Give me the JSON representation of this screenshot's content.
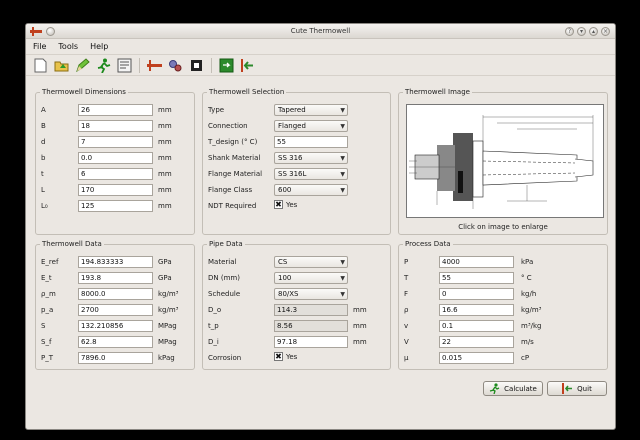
{
  "window": {
    "title": "Cute Thermowell"
  },
  "menu": [
    "File",
    "Tools",
    "Help"
  ],
  "toolbar": {
    "icons": [
      "new-icon",
      "open-icon",
      "pencil-icon",
      "run-icon",
      "report-icon",
      "thermowell-icon",
      "gears-icon",
      "export-icon",
      "save-icon",
      "quit-icon"
    ]
  },
  "dims": {
    "title": "Thermowell Dimensions",
    "rows": [
      {
        "label": "A",
        "value": "26",
        "unit": "mm"
      },
      {
        "label": "B",
        "value": "18",
        "unit": "mm"
      },
      {
        "label": "d",
        "value": "7",
        "unit": "mm"
      },
      {
        "label": "b",
        "value": "0.0",
        "unit": "mm"
      },
      {
        "label": "t",
        "value": "6",
        "unit": "mm"
      },
      {
        "label": "L",
        "value": "170",
        "unit": "mm"
      },
      {
        "label": "L₀",
        "value": "125",
        "unit": "mm"
      }
    ]
  },
  "sel": {
    "title": "Thermowell Selection",
    "rows": [
      {
        "label": "Type",
        "value": "Tapered",
        "kind": "select"
      },
      {
        "label": "Connection",
        "value": "Flanged",
        "kind": "select"
      },
      {
        "label": "T_design (° C)",
        "value": "55",
        "kind": "input"
      },
      {
        "label": "Shank Material",
        "value": "SS 316",
        "kind": "select"
      },
      {
        "label": "Flange Material",
        "value": "SS 316L",
        "kind": "select"
      },
      {
        "label": "Flange Class",
        "value": "600",
        "kind": "select"
      }
    ],
    "ndt_label": "NDT Required",
    "ndt_value": "Yes"
  },
  "image": {
    "title": "Thermowell Image",
    "caption": "Click on image to enlarge"
  },
  "tdata": {
    "title": "Thermowell Data",
    "rows": [
      {
        "label": "E_ref",
        "value": "194.833333",
        "unit": "GPa"
      },
      {
        "label": "E_t",
        "value": "193.8",
        "unit": "GPa"
      },
      {
        "label": "ρ_m",
        "value": "8000.0",
        "unit": "kg/m³"
      },
      {
        "label": "p_a",
        "value": "2700",
        "unit": "kg/m³"
      },
      {
        "label": "S",
        "value": "132.210856",
        "unit": "MPag"
      },
      {
        "label": "S_f",
        "value": "62.8",
        "unit": "MPag"
      },
      {
        "label": "P_T",
        "value": "7896.0",
        "unit": "kPag"
      }
    ]
  },
  "pipe": {
    "title": "Pipe Data",
    "rows": [
      {
        "label": "Material",
        "value": "CS",
        "kind": "select",
        "unit": ""
      },
      {
        "label": "DN (mm)",
        "value": "100",
        "kind": "select",
        "unit": ""
      },
      {
        "label": "Schedule",
        "value": "80/XS",
        "kind": "select",
        "unit": ""
      },
      {
        "label": "D_o",
        "value": "114.3",
        "kind": "ro",
        "unit": "mm"
      },
      {
        "label": "t_p",
        "value": "8.56",
        "kind": "ro",
        "unit": "mm"
      },
      {
        "label": "D_i",
        "value": "97.18",
        "kind": "input",
        "unit": "mm"
      }
    ],
    "corrosion_label": "Corrosion",
    "corrosion_value": "Yes"
  },
  "process": {
    "title": "Process Data",
    "rows": [
      {
        "label": "P",
        "value": "4000",
        "unit": "kPa"
      },
      {
        "label": "T",
        "value": "55",
        "unit": "° C"
      },
      {
        "label": "F",
        "value": "0",
        "unit": "kg/h"
      },
      {
        "label": "ρ",
        "value": "16.6",
        "unit": "kg/m³"
      },
      {
        "label": "v",
        "value": "0.1",
        "unit": "m³/kg"
      },
      {
        "label": "V",
        "value": "22",
        "unit": "m/s"
      },
      {
        "label": "μ",
        "value": "0.015",
        "unit": "cP"
      }
    ]
  },
  "buttons": {
    "calculate": "Calculate",
    "quit": "Quit"
  }
}
